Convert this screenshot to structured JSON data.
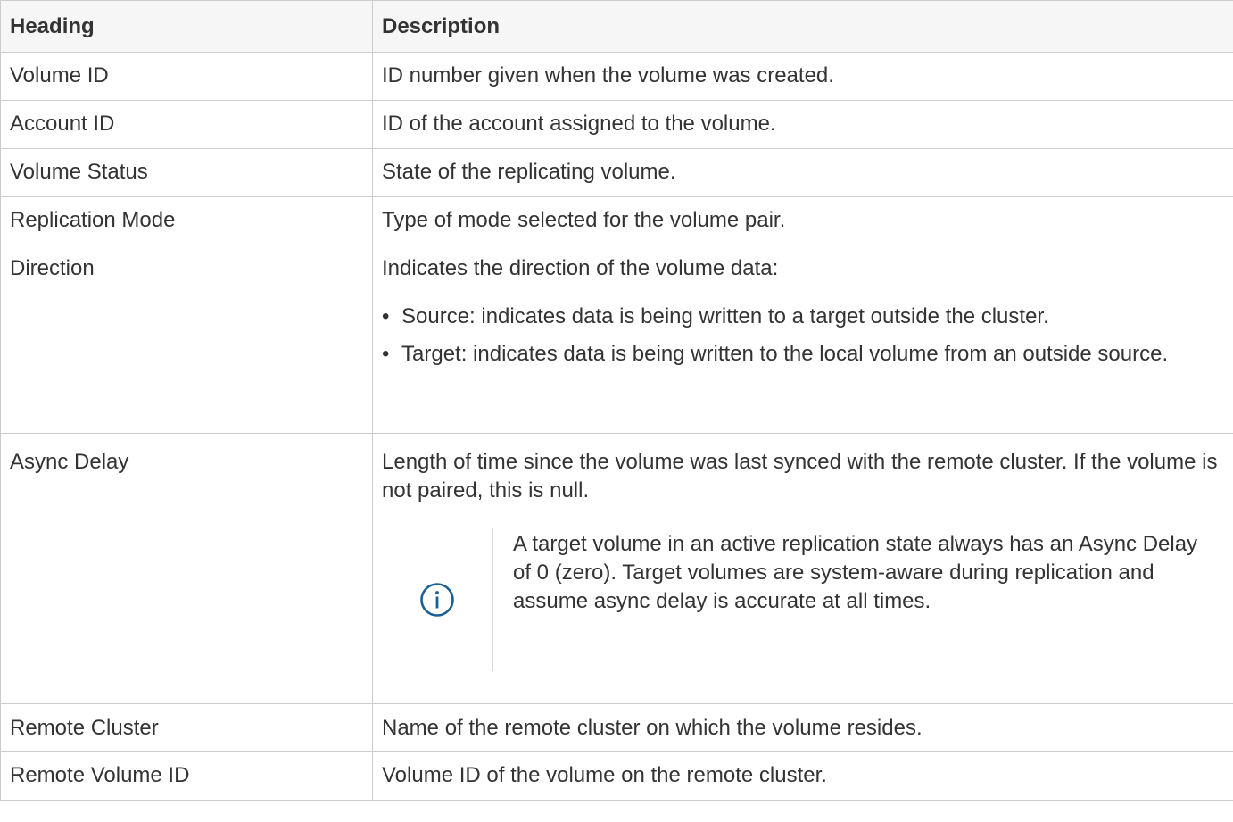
{
  "table": {
    "headers": {
      "heading": "Heading",
      "description": "Description"
    },
    "rows": [
      {
        "heading": "Volume ID",
        "description": "ID number given when the volume was created."
      },
      {
        "heading": "Account ID",
        "description": "ID of the account assigned to the volume."
      },
      {
        "heading": "Volume Status",
        "description": "State of the replicating volume."
      },
      {
        "heading": "Replication Mode",
        "description": "Type of mode selected for the volume pair."
      },
      {
        "heading": "Direction",
        "description": "Indicates the direction of the volume data:",
        "bullets": [
          "Source: indicates data is being written to a target outside the cluster.",
          "Target: indicates data is being written to the local volume from an outside source."
        ]
      },
      {
        "heading": "Async Delay",
        "description": "Length of time since the volume was last synced with the remote cluster. If the volume is not paired, this is null.",
        "note": {
          "icon": "info-icon",
          "text": "A target volume in an active replication state always has an Async Delay of 0 (zero). Target volumes are system-aware during replication and assume async delay is accurate at all times."
        }
      },
      {
        "heading": "Remote Cluster",
        "description": "Name of the remote cluster on which the volume resides."
      },
      {
        "heading": "Remote Volume ID",
        "description": "Volume ID of the volume on the remote cluster."
      }
    ]
  },
  "colors": {
    "header_bg": "#f6f6f6",
    "border": "#cccccc",
    "text": "#333333",
    "icon": "#1a5f95"
  }
}
